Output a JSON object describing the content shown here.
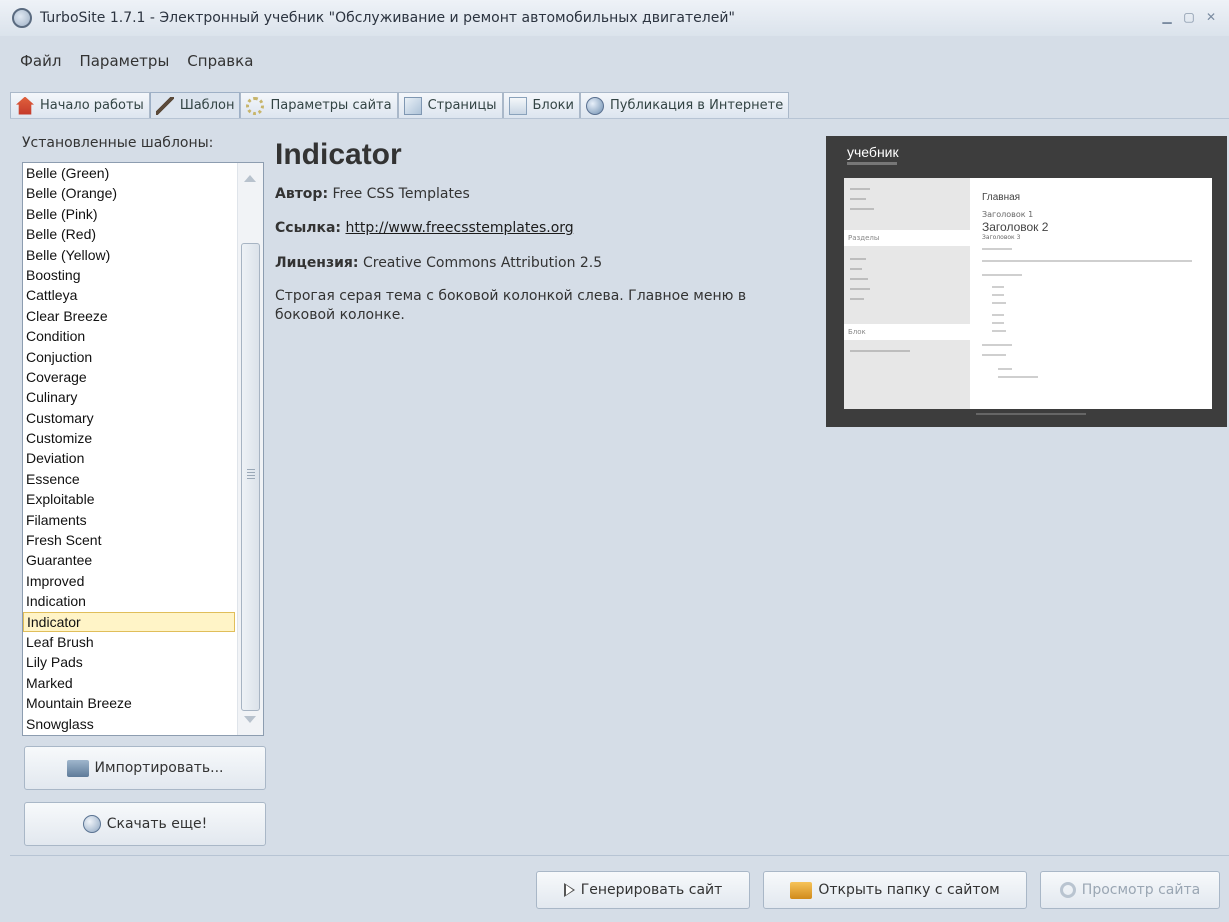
{
  "window": {
    "title": "TurboSite 1.7.1 - Электронный учебник \"Обслуживание и ремонт автомобильных двигателей\"",
    "controls": [
      "minimize-icon",
      "maximize-icon",
      "close-icon"
    ]
  },
  "menu": [
    "Файл",
    "Параметры",
    "Справка"
  ],
  "tabs": [
    {
      "label": "Начало работы",
      "icon": "home-icon"
    },
    {
      "label": "Шаблон",
      "icon": "brush-icon",
      "active": true
    },
    {
      "label": "Параметры сайта",
      "icon": "gear-icon"
    },
    {
      "label": "Страницы",
      "icon": "pages-icon"
    },
    {
      "label": "Блоки",
      "icon": "blocks-icon"
    },
    {
      "label": "Публикация в Интернете",
      "icon": "globe-icon"
    }
  ],
  "sidebar": {
    "label": "Установленные шаблоны:",
    "templates": [
      "Belle (Green)",
      "Belle (Orange)",
      "Belle (Pink)",
      "Belle (Red)",
      "Belle (Yellow)",
      "Boosting",
      "Cattleya",
      "Clear Breeze",
      "Condition",
      "Conjuction",
      "Coverage",
      "Culinary",
      "Customary",
      "Customize",
      "Deviation",
      "Essence",
      "Exploitable",
      "Filaments",
      "Fresh Scent",
      "Guarantee",
      "Improved",
      "Indication",
      "Indicator",
      "Leaf Brush",
      "Lily Pads",
      "Marked",
      "Mountain Breeze",
      "Snowglass"
    ],
    "selected": "Indicator",
    "import_label": "Импортировать...",
    "download_label": "Скачать еще!"
  },
  "details": {
    "name": "Indicator",
    "author_label": "Автор:",
    "author": "Free CSS Templates",
    "link_label": "Ссылка:",
    "link": "http://www.freecsstemplates.org",
    "license_label": "Лицензия:",
    "license": "Creative Commons Attribution 2.5",
    "description": "Строгая серая тема с боковой колонкой слева. Главное меню в боковой колонке."
  },
  "preview": {
    "logo": "учебник",
    "sidebar_sections": [
      "Разделы",
      "Блок"
    ],
    "main_title": "Главная",
    "heading1": "Заголовок 1",
    "heading2": "Заголовок 2",
    "heading3": "Заголовок 3"
  },
  "footer": {
    "generate_label": "Генерировать сайт",
    "open_folder_label": "Открыть папку с сайтом",
    "preview_label": "Просмотр сайта"
  }
}
